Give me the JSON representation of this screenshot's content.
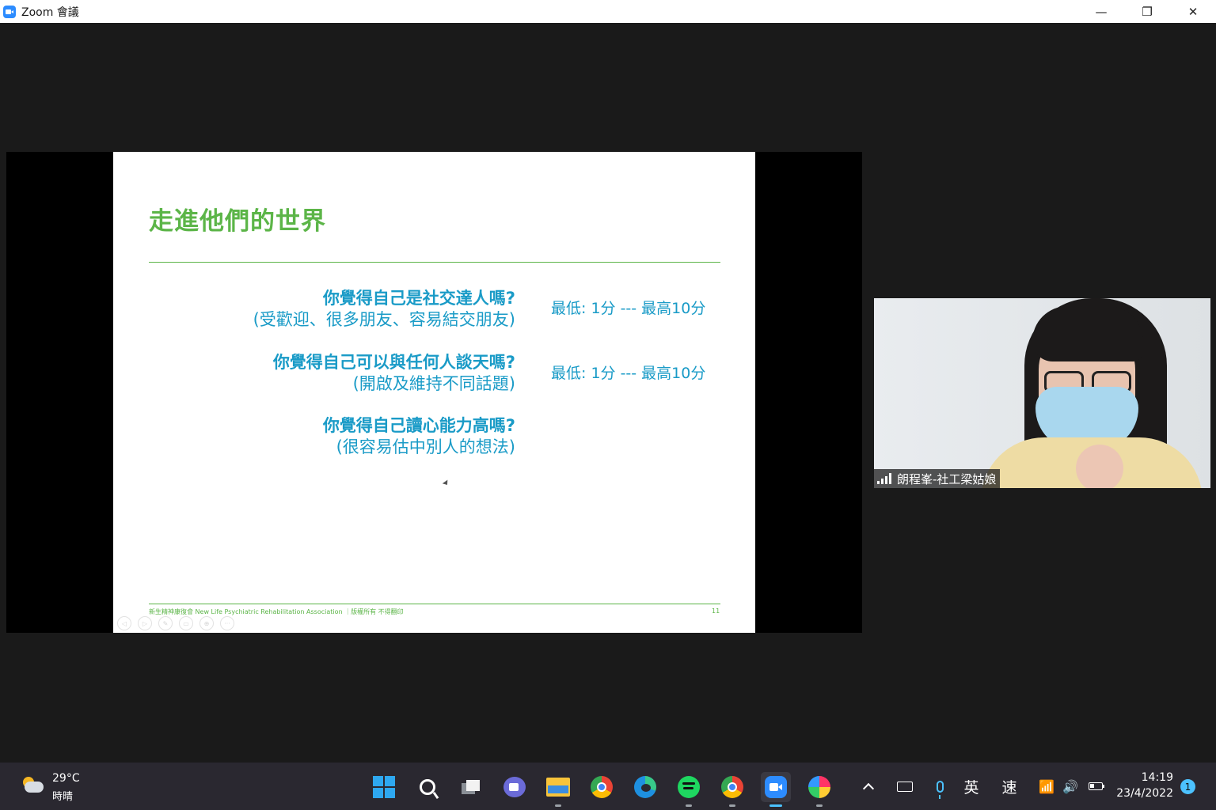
{
  "window": {
    "title": "Zoom 會議",
    "controls": {
      "minimize": "—",
      "restore": "❐",
      "close": "✕"
    }
  },
  "slide": {
    "title": "走進他們的世界",
    "questions": [
      {
        "main": "你覺得自己是社交達人嗎?",
        "sub": "(受歡迎、很多朋友、容易結交朋友)",
        "score": "最低: 1分 --- 最高10分"
      },
      {
        "main": "你覺得自己可以與任何人談天嗎?",
        "sub": "(開啟及維持不同話題)",
        "score": "最低: 1分 --- 最高10分"
      },
      {
        "main": "你覺得自己讀心能力高嗎?",
        "sub": "(很容易估中別人的想法)"
      }
    ],
    "footer": "新生精神康復會 New Life Psychiatric Rehabilitation Association ｜版權所有 不得翻印",
    "page_number": "11",
    "tools": [
      "◁",
      "▷",
      "✎",
      "▭",
      "⊕",
      "···"
    ]
  },
  "participant": {
    "name": "朗程峯-社工梁姑娘"
  },
  "taskbar": {
    "weather": {
      "temperature": "29°C",
      "condition": "時晴"
    },
    "apps": [
      "start",
      "search",
      "task-view",
      "teams-chat",
      "file-explorer",
      "chrome",
      "edge",
      "spotify",
      "chrome",
      "zoom",
      "paint"
    ],
    "ime_mode": "英",
    "ime_speed": "速",
    "time": "14:19",
    "date": "23/4/2022",
    "notification_count": "1",
    "battery_level": 0.35
  },
  "colors": {
    "slide_green": "#5cb548",
    "slide_blue": "#1a9bc7",
    "zoom_blue": "#2d8cff",
    "accent": "#4cc2ff"
  }
}
